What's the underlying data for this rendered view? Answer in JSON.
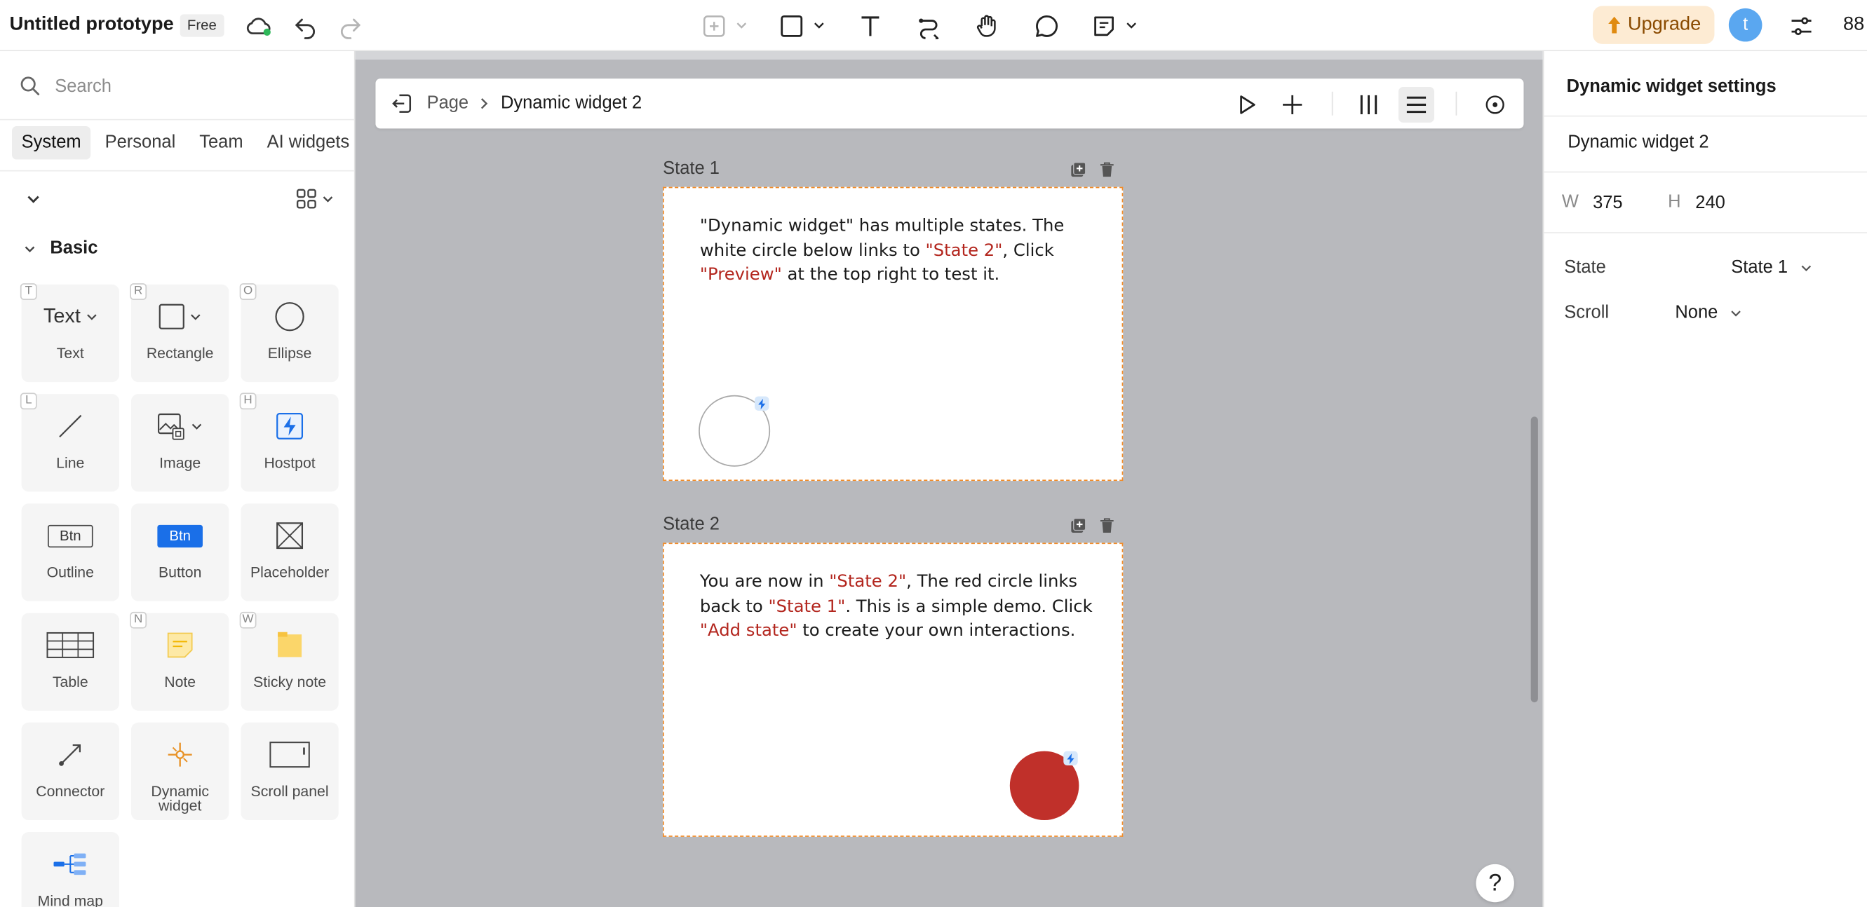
{
  "app": {
    "title": "Untitled prototype",
    "plan": "Free",
    "upgrade_label": "Upgrade",
    "avatar_initial": "t",
    "zoom": "88"
  },
  "toolbar": {
    "icons": [
      "cloud-sync-icon",
      "undo-icon",
      "redo-icon",
      "frame-icon",
      "rectangle-icon",
      "text-icon",
      "connector-icon",
      "hand-icon",
      "comment-icon",
      "note-icon",
      "settings-sliders-icon"
    ]
  },
  "left_panel": {
    "search_placeholder": "Search",
    "tabs": [
      {
        "label": "System",
        "active": true
      },
      {
        "label": "Personal",
        "active": false
      },
      {
        "label": "Team",
        "active": false
      },
      {
        "label": "AI widgets",
        "active": false
      }
    ],
    "section_title": "Basic",
    "components": [
      {
        "label": "Text",
        "glyph_text": "Text",
        "shortcut": "T",
        "icon": "text-icon"
      },
      {
        "label": "Rectangle",
        "shortcut": "R",
        "icon": "rectangle-icon"
      },
      {
        "label": "Ellipse",
        "shortcut": "O",
        "icon": "ellipse-icon"
      },
      {
        "label": "Line",
        "shortcut": "L",
        "icon": "line-icon"
      },
      {
        "label": "Image",
        "shortcut": "",
        "icon": "image-icon"
      },
      {
        "label": "Hostpot",
        "shortcut": "H",
        "icon": "hotspot-icon"
      },
      {
        "label": "Outline",
        "glyph_text": "Btn",
        "shortcut": "",
        "icon": "outline-button-icon"
      },
      {
        "label": "Button",
        "glyph_text": "Btn",
        "shortcut": "",
        "icon": "button-icon"
      },
      {
        "label": "Placeholder",
        "shortcut": "",
        "icon": "placeholder-icon"
      },
      {
        "label": "Table",
        "shortcut": "",
        "icon": "table-icon"
      },
      {
        "label": "Note",
        "shortcut": "N",
        "icon": "note-icon"
      },
      {
        "label": "Sticky note",
        "shortcut": "W",
        "icon": "sticky-note-icon"
      },
      {
        "label": "Connector",
        "shortcut": "",
        "icon": "connector-icon"
      },
      {
        "label": "Dynamic widget",
        "shortcut": "",
        "icon": "dynamic-widget-icon"
      },
      {
        "label": "Scroll panel",
        "shortcut": "",
        "icon": "scroll-panel-icon"
      },
      {
        "label": "Mind map",
        "shortcut": "",
        "icon": "mind-map-icon"
      }
    ]
  },
  "canvas": {
    "breadcrumb": {
      "page": "Page",
      "current": "Dynamic widget 2"
    },
    "states": [
      {
        "title": "State 1",
        "text_parts": [
          {
            "t": "\"Dynamic widget\" has multiple states. The white circle below links to ",
            "hl": false
          },
          {
            "t": "\"State 2\"",
            "hl": true
          },
          {
            "t": ", Click ",
            "hl": false
          },
          {
            "t": "\"Preview\"",
            "hl": true
          },
          {
            "t": " at the top right to test it.",
            "hl": false
          }
        ]
      },
      {
        "title": "State 2",
        "text_parts": [
          {
            "t": "You are now in ",
            "hl": false
          },
          {
            "t": "\"State 2\"",
            "hl": true
          },
          {
            "t": ", The red circle links back to ",
            "hl": false
          },
          {
            "t": "\"State 1\"",
            "hl": true
          },
          {
            "t": ". This is a simple demo. Click ",
            "hl": false
          },
          {
            "t": "\"Add state\"",
            "hl": true
          },
          {
            "t": " to create your own interactions.",
            "hl": false
          }
        ]
      }
    ],
    "help_label": "?"
  },
  "right_panel": {
    "title": "Dynamic widget settings",
    "widget_name": "Dynamic widget 2",
    "w_label": "W",
    "w_value": "375",
    "h_label": "H",
    "h_value": "240",
    "state_label": "State",
    "state_value": "State 1",
    "scroll_label": "Scroll",
    "scroll_value": "None"
  },
  "colors": {
    "accent_red": "#c0302a",
    "highlight_text": "#b3261e",
    "state_border": "#f08c2a",
    "canvas_bg": "#b8b9bd",
    "upgrade_bg": "#fdebd3",
    "button_blue": "#1a6fe8"
  }
}
